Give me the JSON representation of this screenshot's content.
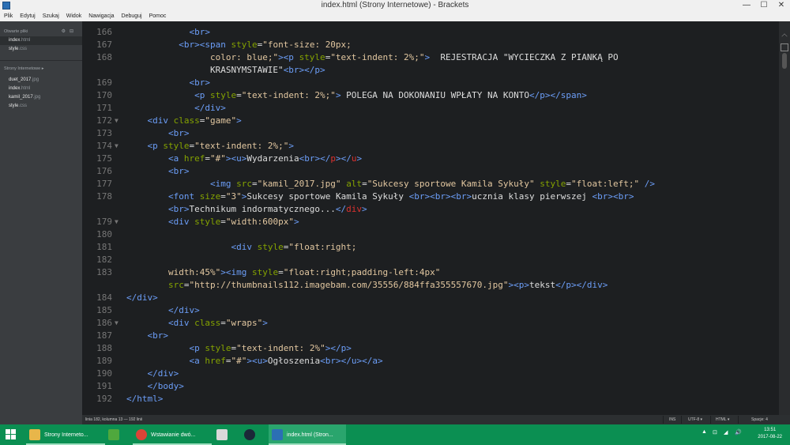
{
  "window": {
    "title": "index.html (Strony Internetowe) - Brackets",
    "controls": [
      "—",
      "☐",
      "✕"
    ]
  },
  "menu": [
    "Plik",
    "Edytuj",
    "Szukaj",
    "Widok",
    "Nawigacja",
    "Debuguj",
    "Pomoc"
  ],
  "sidebar": {
    "open_files_title": "Otwarte pliki",
    "open_files": [
      {
        "name": "index",
        "ext": ".html"
      },
      {
        "name": "style",
        "ext": ".css"
      }
    ],
    "project_title": "Strony Internetowe",
    "project_files": [
      {
        "name": "duet_2017",
        "ext": ".jpg"
      },
      {
        "name": "index",
        "ext": ".html"
      },
      {
        "name": "kamil_2017",
        "ext": ".jpg"
      },
      {
        "name": "style",
        "ext": ".css"
      }
    ]
  },
  "editor": {
    "lines": [
      {
        "n": "166",
        "fold": "",
        "html": "            <span class='t'>&lt;br&gt;</span>"
      },
      {
        "n": "167",
        "fold": "",
        "html": "          <span class='t'>&lt;br&gt;&lt;span</span> <span class='a'>style</span>=<span class='s'>\"font-size: 20px;</span>"
      },
      {
        "n": "168",
        "fold": "",
        "html": "                <span class='s'>color: blue;\"</span><span class='t'>&gt;&lt;p</span> <span class='a'>style</span>=<span class='s'>\"text-indent: 2%;\"</span><span class='t'>&gt;</span>  REJESTRACJA \"WYCIECZKA Z PIANKĄ PO"
      },
      {
        "n": "",
        "fold": "",
        "html": "                KRASNYMSTAWIE\"<span class='t'>&lt;br&gt;&lt;/p&gt;</span>"
      },
      {
        "n": "169",
        "fold": "",
        "html": "            <span class='t'>&lt;br&gt;</span>"
      },
      {
        "n": "170",
        "fold": "",
        "html": "             <span class='t'>&lt;p</span> <span class='a'>style</span>=<span class='s'>\"text-indent: 2%;\"</span><span class='t'>&gt;</span> POLEGA NA DOKONANIU WPŁATY NA KONTO<span class='t'>&lt;/p&gt;&lt;/span&gt;</span>"
      },
      {
        "n": "171",
        "fold": "",
        "html": "             <span class='t'>&lt;/div&gt;</span>"
      },
      {
        "n": "172",
        "fold": "▼",
        "html": "    <span class='t'>&lt;div</span> <span class='a'>class</span>=<span class='s'>\"game\"</span><span class='t'>&gt;</span>"
      },
      {
        "n": "173",
        "fold": "",
        "html": "        <span class='t'>&lt;br&gt;</span>"
      },
      {
        "n": "174",
        "fold": "▼",
        "html": "    <span class='t'>&lt;p</span> <span class='a'>style</span>=<span class='s'>\"text-indent: 2%;\"</span><span class='t'>&gt;</span>"
      },
      {
        "n": "175",
        "fold": "",
        "html": "        <span class='t'>&lt;a</span> <span class='a'>href</span>=<span class='s'>\"#\"</span><span class='t'>&gt;&lt;u&gt;</span>Wydarzenia<span class='t'>&lt;br&gt;&lt;/</span><span class='r'>p</span><span class='t'>&gt;&lt;/</span><span class='r'>u</span><span class='t'>&gt;</span>"
      },
      {
        "n": "176",
        "fold": "",
        "html": "        <span class='t'>&lt;br&gt;</span>"
      },
      {
        "n": "177",
        "fold": "",
        "html": "                <span class='t'>&lt;img</span> <span class='a'>src</span>=<span class='s'>\"kamil_2017.jpg\"</span> <span class='a'>alt</span>=<span class='s'>\"Sukcesy sportowe Kamila Sykuły\"</span> <span class='a'>style</span>=<span class='s'>\"float:left;\"</span> <span class='t'>/&gt;</span>"
      },
      {
        "n": "178",
        "fold": "",
        "html": "        <span class='t'>&lt;font</span> <span class='a'>size</span>=<span class='s'>\"3\"</span><span class='t'>&gt;</span>Sukcesy sportowe Kamila Sykuły <span class='t'>&lt;br&gt;&lt;br&gt;&lt;br&gt;</span>ucznia klasy pierwszej <span class='t'>&lt;br&gt;&lt;br&gt;</span>"
      },
      {
        "n": "",
        "fold": "",
        "html": "        <span class='t'>&lt;br&gt;</span>Technikum indormatycznego...<span class='t'>&lt;/</span><span class='r'>div</span><span class='t'>&gt;</span>"
      },
      {
        "n": "179",
        "fold": "▼",
        "html": "        <span class='t'>&lt;div</span> <span class='a'>style</span>=<span class='s'>\"width:600px\"</span><span class='t'>&gt;</span>"
      },
      {
        "n": "180",
        "fold": "",
        "html": ""
      },
      {
        "n": "181",
        "fold": "",
        "html": "                    <span class='t'>&lt;div</span> <span class='a'>style</span>=<span class='s'>\"float:right;</span>"
      },
      {
        "n": "182",
        "fold": "",
        "html": ""
      },
      {
        "n": "183",
        "fold": "",
        "html": "        <span class='s'>width:45%\"</span><span class='t'>&gt;&lt;img</span> <span class='a'>style</span>=<span class='s'>\"float:right;padding-left:4px\"</span>"
      },
      {
        "n": "",
        "fold": "",
        "html": "        <span class='a'>src</span>=<span class='s'>\"http://thumbnails112.imagebam.com/35556/884ffa355557670.jpg\"</span><span class='t'>&gt;&lt;p&gt;</span>tekst<span class='t'>&lt;/p&gt;&lt;/div&gt;</span>"
      },
      {
        "n": "184",
        "fold": "",
        "html": "<span class='t'>&lt;/div&gt;</span>"
      },
      {
        "n": "185",
        "fold": "",
        "html": "        <span class='t'>&lt;/div&gt;</span>"
      },
      {
        "n": "186",
        "fold": "▼",
        "html": "        <span class='t'>&lt;div</span> <span class='a'>class</span>=<span class='s'>\"wraps\"</span><span class='t'>&gt;</span>"
      },
      {
        "n": "187",
        "fold": "",
        "html": "    <span class='t'>&lt;br&gt;</span>"
      },
      {
        "n": "188",
        "fold": "",
        "html": "            <span class='t'>&lt;p</span> <span class='a'>style</span>=<span class='s'>\"text-indent: 2%\"</span><span class='t'>&gt;&lt;/p&gt;</span>"
      },
      {
        "n": "189",
        "fold": "",
        "html": "            <span class='t'>&lt;a</span> <span class='a'>href</span>=<span class='s'>\"#\"</span><span class='t'>&gt;&lt;u&gt;</span>Ogłoszenia<span class='t'>&lt;br&gt;&lt;/u&gt;&lt;/a&gt;</span>"
      },
      {
        "n": "190",
        "fold": "",
        "html": "    <span class='t'>&lt;/div&gt;</span>"
      },
      {
        "n": "191",
        "fold": "",
        "html": "    <span class='t'>&lt;/body&gt;</span>"
      },
      {
        "n": "192",
        "fold": "",
        "html": "<span class='t'>&lt;/html&gt;</span>"
      }
    ]
  },
  "statusbar": {
    "position": "linia 182, kolumna 13 — 192 linii",
    "ins": "INS",
    "encoding": "UTF-8 ▾",
    "language": "HTML ▾",
    "spaces": "Spacje: 4"
  },
  "taskbar": {
    "items": [
      {
        "label": "Strony Interneto...",
        "icon_color": "#e8b64a",
        "active": false
      },
      {
        "label": "",
        "icon_color": "#4fa83d",
        "active": false
      },
      {
        "label": "Wstawianie dwó...",
        "icon_color": "#db4437",
        "active": false
      },
      {
        "label": "",
        "icon_color": "#d9d9d9",
        "active": false
      },
      {
        "label": "",
        "icon_color": "#1b2838",
        "active": false
      },
      {
        "label": "index.html (Stron...",
        "icon_color": "#2b6fb4",
        "active": true
      }
    ],
    "tray_icons": [
      "▲",
      "⊡",
      "◢",
      "🔊"
    ],
    "time": "13:51",
    "date": "2017-08-22"
  },
  "colors": {
    "editor_bg": "#1d1f21",
    "tag": "#6c9ef8",
    "attribute": "#85a300",
    "string": "#e2c7a0",
    "taskbar": "#0b8f52"
  }
}
